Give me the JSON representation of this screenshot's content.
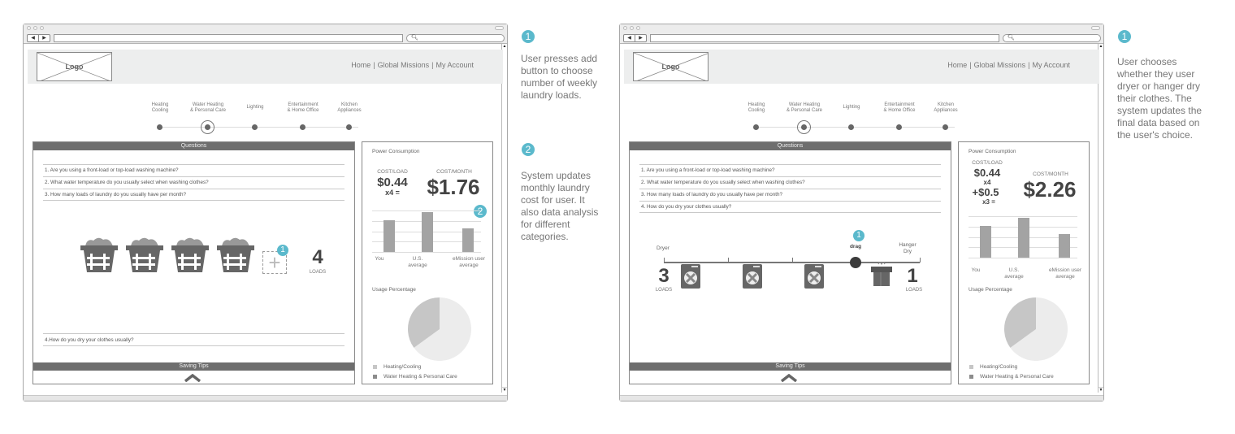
{
  "screens": [
    {
      "browser": {
        "nav_back": "◀",
        "nav_forward": "▶",
        "url_value": "",
        "search_icon": "🔍︎",
        "search_value": ""
      },
      "header": {
        "logo_text": "Logo",
        "nav": [
          "Home",
          "Global Missions",
          "My Account"
        ],
        "separator": "|"
      },
      "categories": [
        {
          "label": "Heating\nCooling",
          "selected": false
        },
        {
          "label": "Water Heating\n& Personal Care",
          "selected": true
        },
        {
          "label": "Lighting",
          "selected": false
        },
        {
          "label": "Entertainment\n& Home Office",
          "selected": false
        },
        {
          "label": "Kitchen\nAppliances",
          "selected": false
        }
      ],
      "questions_panel": {
        "title": "Questions",
        "questions": [
          "1. Are you using a front-load or top-load washing machine?",
          "2. What water temperature do you usually select when washing clothes?",
          "3. How many loads of laundry do you usually have per month?"
        ],
        "question4": "4.How do you dry your clothes usually?",
        "basket_count": 4,
        "add_button": "+",
        "loads_value": "4",
        "loads_label": "LOADS",
        "saving_tips": "Saving Tips"
      },
      "power_panel": {
        "title": "Power Consumption",
        "cost_load_label": "COST/LOAD",
        "cost_load_value": "$0.44",
        "cost_multiplier": "x4 =",
        "cost_month_label": "COST/MONTH",
        "cost_month_value": "$1.76",
        "usage_title": "Usage Percentage"
      },
      "badges": {
        "add": "1",
        "cost": "2"
      },
      "annotations": [
        {
          "number": "1",
          "text": "User presses add button to choose number of weekly laundry loads."
        },
        {
          "number": "2",
          "text": "System updates monthly laundry cost for user. It also data analysis for different categories."
        }
      ]
    },
    {
      "browser": {
        "nav_back": "◀",
        "nav_forward": "▶",
        "url_value": "",
        "search_icon": "🔍︎",
        "search_value": ""
      },
      "header": {
        "logo_text": "Logo",
        "nav": [
          "Home",
          "Global Missions",
          "My Account"
        ],
        "separator": "|"
      },
      "categories": [
        {
          "label": "Heating\nCooling",
          "selected": false
        },
        {
          "label": "Water Heating\n& Personal Care",
          "selected": true
        },
        {
          "label": "Lighting",
          "selected": false
        },
        {
          "label": "Entertainment\n& Home Office",
          "selected": false
        },
        {
          "label": "Kitchen\nAppliances",
          "selected": false
        }
      ],
      "questions_panel": {
        "title": "Questions",
        "questions": [
          "1. Are you using a front-load or top-load washing machine?",
          "2. What water temperature do you usually select when washing clothes?",
          "3. How many loads of laundry do you usually have per month?",
          "4. How do you dry your clothes usually?"
        ],
        "slider": {
          "left_label": "Dryer",
          "right_label": "Hanger\nDry",
          "handle_label": "drag",
          "dryer_loads": "3",
          "hanger_loads": "1",
          "loads_label": "LOADS",
          "steps": 4,
          "value_dryer_fraction": 0.75
        },
        "saving_tips": "Saving Tips"
      },
      "power_panel": {
        "title": "Power Consumption",
        "cost_load_label": "COST/LOAD",
        "cost_load_value": "$0.44",
        "cost_multiplier": "x4",
        "cost_extra_value": "+$0.5",
        "cost_extra_multiplier": "x3 =",
        "cost_month_label": "COST/MONTH",
        "cost_month_value": "$2.26",
        "usage_title": "Usage Percentage"
      },
      "badges": {
        "drag": "1"
      },
      "annotations": [
        {
          "number": "1",
          "text": "User chooses whether they user dryer or hanger dry their clothes. The system updates the final data based on the user's choice."
        }
      ]
    }
  ],
  "chart_data": [
    {
      "type": "bar",
      "title": "Power Consumption",
      "categories": [
        "You",
        "U.S.\naverage",
        "eMission user\naverage"
      ],
      "values": [
        4.0,
        5.0,
        3.0
      ],
      "ylim": [
        0,
        6
      ],
      "grid": true,
      "xlabel": "",
      "ylabel": ""
    },
    {
      "type": "pie",
      "title": "Usage Percentage",
      "labels": [
        "Heating/Cooling",
        "Water Heating & Personal Care"
      ],
      "values": [
        65,
        35
      ],
      "colors": [
        "#ececec",
        "#c6c6c6"
      ],
      "legend_position": "bottom-left"
    },
    {
      "type": "bar",
      "title": "Power Consumption",
      "categories": [
        "You",
        "U.S.\naverage",
        "eMission user\naverage"
      ],
      "values": [
        4.0,
        5.0,
        3.0
      ],
      "ylim": [
        0,
        6
      ],
      "grid": true,
      "xlabel": "",
      "ylabel": ""
    },
    {
      "type": "pie",
      "title": "Usage Percentage",
      "labels": [
        "Heating/Cooling",
        "Water Heating & Personal Care"
      ],
      "values": [
        65,
        35
      ],
      "colors": [
        "#ececec",
        "#c6c6c6"
      ],
      "legend_position": "bottom-left"
    }
  ],
  "colors": {
    "accent_badge": "#5bb9cc",
    "panel_header": "#6e6e6e",
    "header_bg": "#edeeee",
    "bar": "#a3a3a3",
    "icon_dark": "#666666"
  }
}
